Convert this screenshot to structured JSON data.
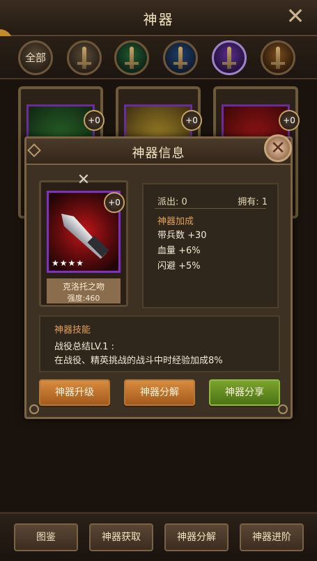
{
  "header": {
    "title": "神器"
  },
  "filters": [
    {
      "label": "全部"
    }
  ],
  "bg_cards": [
    {
      "plus": "+0"
    },
    {
      "plus": "+0"
    },
    {
      "plus": "+0"
    }
  ],
  "modal": {
    "title": "神器信息",
    "item": {
      "plus": "+0",
      "stars": "★★★★",
      "name": "克洛托之吻",
      "power": "强度:460"
    },
    "stats": {
      "deployed": "派出: 0",
      "owned": "拥有: 1",
      "bonus_title": "神器加成",
      "bonus_lines": [
        "带兵数 +30",
        "血量 +6%",
        "闪避 +5%"
      ]
    },
    "skill": {
      "title": "神器技能",
      "name": "战役总结LV.1 :",
      "desc": "在战役、精英挑战的战斗中时经验加成8%"
    },
    "buttons": {
      "upgrade": "神器升级",
      "decompose": "神器分解",
      "share": "神器分享"
    }
  },
  "bottom_nav": [
    "图鉴",
    "神器获取",
    "神器分解",
    "神器进阶"
  ],
  "colors": {
    "accent_orange": "#d88c3f",
    "accent_green": "#7aa42d",
    "purple_frame": "#7f2fc2"
  }
}
